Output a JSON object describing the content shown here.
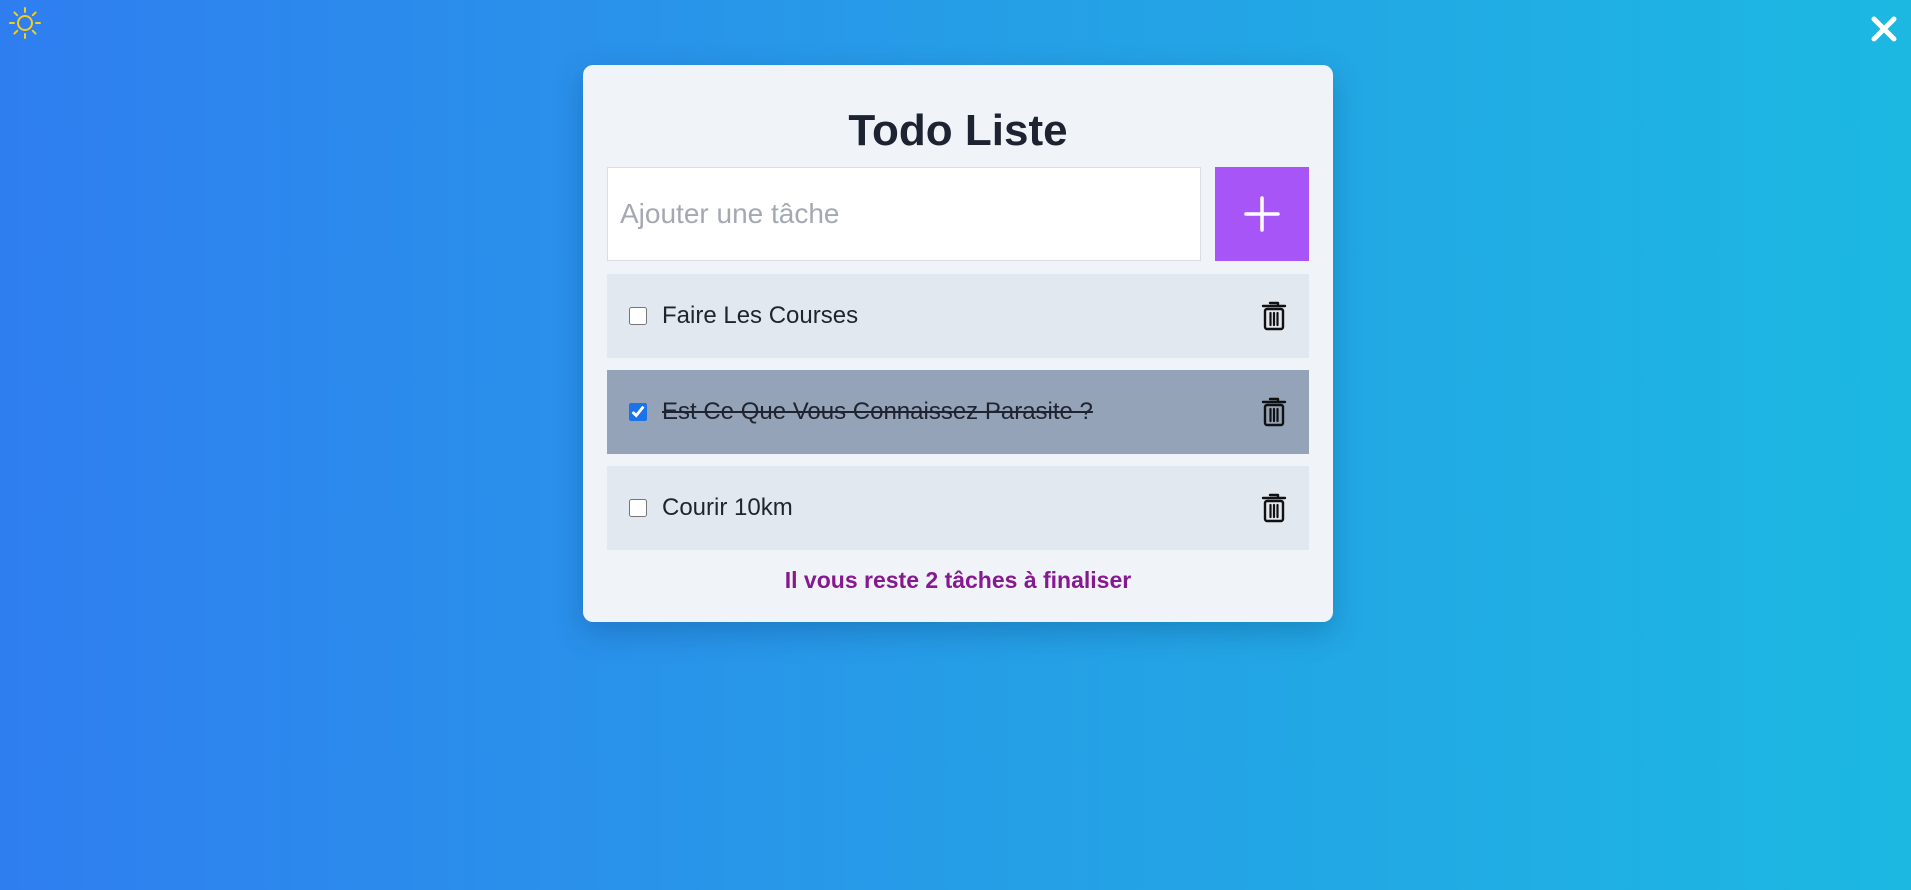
{
  "app": {
    "title": "Todo Liste"
  },
  "icons": {
    "theme_toggle": "sun-icon",
    "close": "close-icon",
    "add": "plus-icon",
    "delete": "trash-icon"
  },
  "colors": {
    "background_start": "#2f7ef0",
    "background_end": "#1cb8e2",
    "accent": "#a855f7",
    "footer_text": "#86198f",
    "sun": "#facc15"
  },
  "add_task": {
    "placeholder": "Ajouter une tâche",
    "value": ""
  },
  "tasks": [
    {
      "label": "Faire Les Courses",
      "completed": false
    },
    {
      "label": "Est Ce Que Vous Connaissez Parasite ?",
      "completed": true
    },
    {
      "label": "Courir 10km",
      "completed": false
    }
  ],
  "footer": {
    "remaining_text": "Il vous reste 2 tâches à finaliser"
  }
}
